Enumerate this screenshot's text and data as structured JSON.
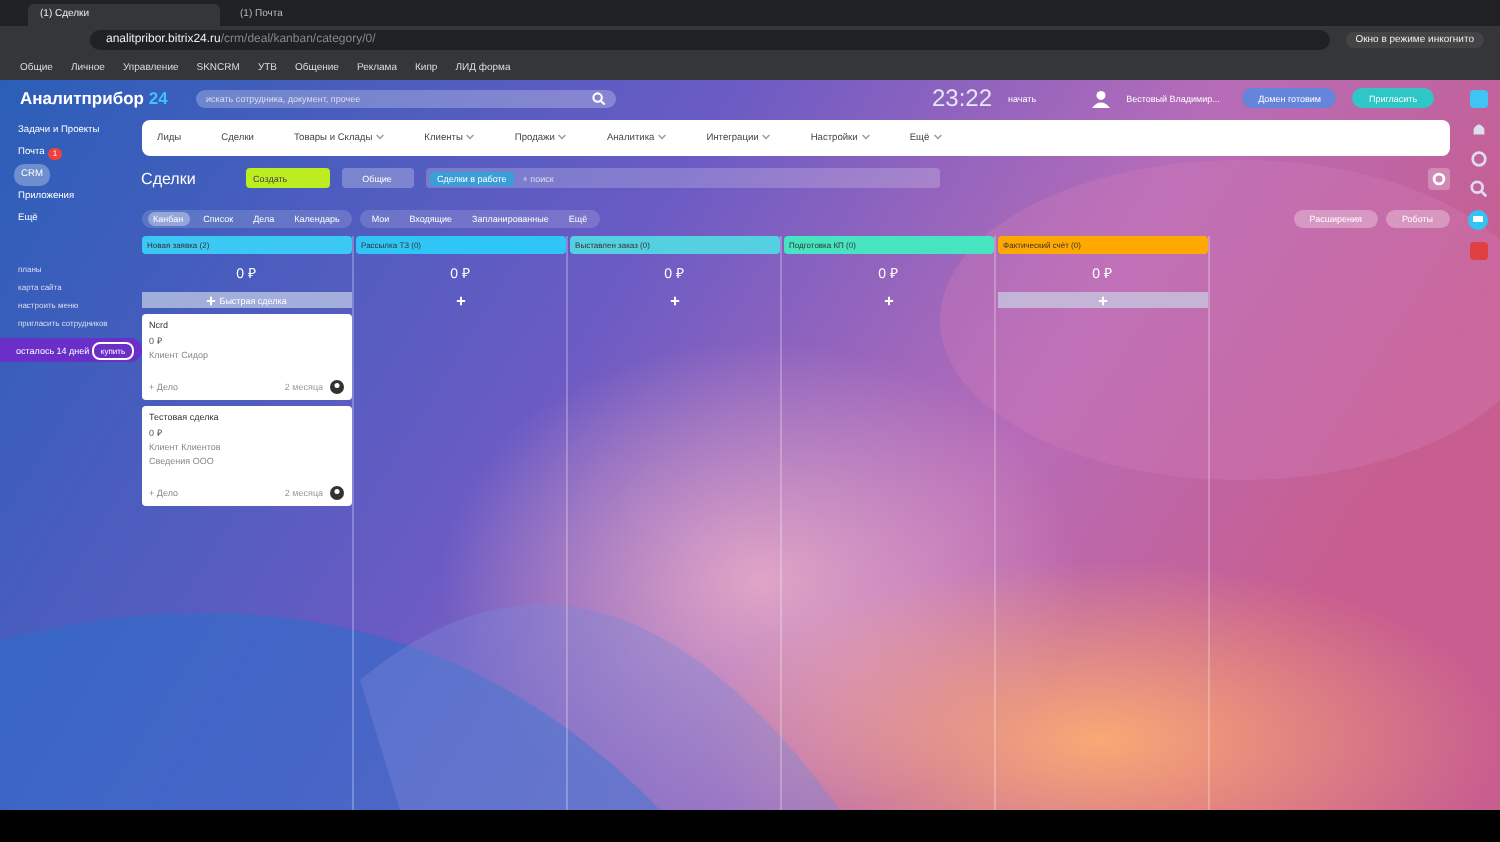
{
  "browser": {
    "tabs": [
      {
        "title": "(1) Сделки",
        "selected": true
      },
      {
        "title": "(1) Почта",
        "selected": false
      }
    ],
    "address_host": "analitpribor.bitrix24.ru",
    "address_path": "/crm/deal/kanban/category/0/",
    "bookmarks": [
      "Общие",
      "Личное",
      "Управление",
      "SKNCRM",
      "УТВ",
      "Общение",
      "Реклама",
      "Кипр",
      "ЛИД форма"
    ],
    "incognito": "Окно в режиме инкогнито"
  },
  "header": {
    "logo": "Аналитприбор",
    "logo_suffix": "24",
    "search_placeholder": "искать сотрудника, документ, прочее",
    "clock": "23:22",
    "clock_action": "начать",
    "user": "Вестовый Владимир...",
    "domain_button": "Домен готовим",
    "invite_button": "Пригласить"
  },
  "sidebar": {
    "items": [
      {
        "label": "Задачи и Проекты",
        "selected": false
      },
      {
        "label": "Почта",
        "selected": false,
        "badge": "1"
      },
      {
        "label": "CRM",
        "selected": true
      },
      {
        "label": "Приложения",
        "selected": false
      },
      {
        "label": "Ещё",
        "selected": false
      }
    ],
    "links": [
      "планы",
      "карта сайта",
      "настроить меню",
      "пригласить сотрудников"
    ],
    "promo": {
      "text": "осталось 14 дней",
      "button": "купить"
    }
  },
  "nav": [
    {
      "label": "Лиды",
      "menu": false
    },
    {
      "label": "Сделки",
      "menu": false
    },
    {
      "label": "Товары и Склады",
      "menu": true
    },
    {
      "label": "Клиенты",
      "menu": true
    },
    {
      "label": "Продажи",
      "menu": true
    },
    {
      "label": "Аналитика",
      "menu": true
    },
    {
      "label": "Интеграции",
      "menu": true
    },
    {
      "label": "Настройки",
      "menu": true
    },
    {
      "label": "Ещё",
      "menu": true
    }
  ],
  "toolbar": {
    "title": "Сделки",
    "create_button": "Создать",
    "filter_button": "Общие",
    "filter_tag": "Сделки в работе",
    "search_placeholder": "+ поиск"
  },
  "views": [
    {
      "label": "Канбан",
      "selected": true
    },
    {
      "label": "Список",
      "selected": false
    },
    {
      "label": "Дела",
      "selected": false
    },
    {
      "label": "Календарь",
      "selected": false
    }
  ],
  "counters": [
    "Мои",
    "Входящие",
    "Запланированные",
    "Ещё"
  ],
  "right_buttons": [
    "Расширения",
    "Роботы"
  ],
  "columns": [
    {
      "title": "Новая заявка (2)",
      "color": "#3bc8f5",
      "sum": "0 ₽",
      "add_bar": true,
      "add_label": "Быстрая сделка",
      "cards": [
        {
          "title": "Ncrd",
          "amount": "0 ₽",
          "lines": [
            "Клиент Сидор"
          ],
          "activity": "+ Дело",
          "time": "2 месяца"
        },
        {
          "title": "Тестовая сделка",
          "amount": "0 ₽",
          "lines": [
            "Клиент Клиентов",
            "Сведения ООО"
          ],
          "activity": "+ Дело",
          "time": "2 месяца"
        }
      ]
    },
    {
      "title": "Рассылка ТЗ (0)",
      "color": "#2fc6f6",
      "sum": "0 ₽",
      "add_bar": false
    },
    {
      "title": "Выставлен заказ (0)",
      "color": "#55d0e0",
      "sum": "0 ₽",
      "add_bar": false
    },
    {
      "title": "Подготовка КП (0)",
      "color": "#47e4c2",
      "sum": "0 ₽",
      "add_bar": false
    },
    {
      "title": "Фактический счёт (0)",
      "color": "#ffa900",
      "sum": "0 ₽",
      "add_bar": true
    }
  ]
}
